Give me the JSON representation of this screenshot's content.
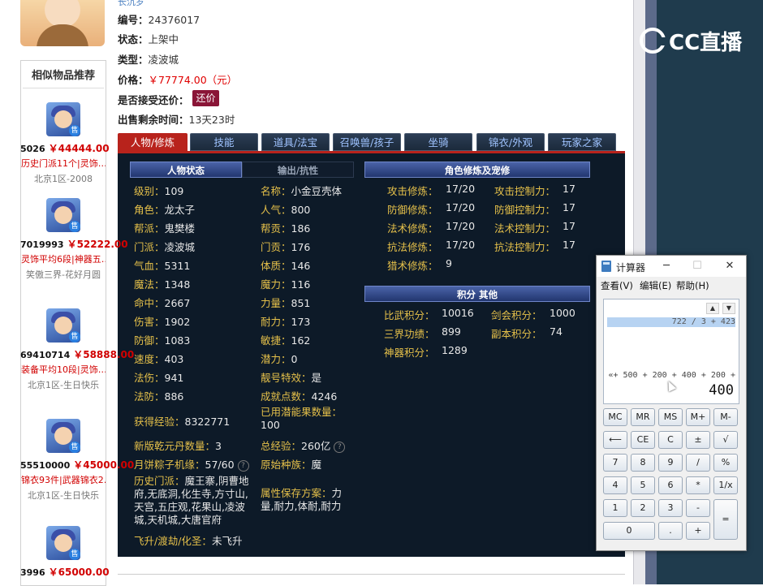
{
  "left": {
    "similar_title": "相似物品推荐",
    "items": [
      {
        "id": "5026",
        "price": "￥44444.00",
        "desc": "历史门派11个|灵饰…",
        "server": "北京1区-2008"
      },
      {
        "id": "7019993",
        "price": "￥52222.00",
        "desc": "灵饰平均6段|神器五…",
        "server": "笑傲三界-花好月圆"
      },
      {
        "id": "69410714",
        "price": "￥58888.00",
        "desc": "装备平均10段|灵饰…",
        "server": "北京1区-生日快乐"
      },
      {
        "id": "55510000",
        "price": "￥45000.00",
        "desc": "锦衣93件|武器锦衣2…",
        "server": "北京1区-生日快乐"
      },
      {
        "id": "3996",
        "price": "￥65000.00",
        "desc": "",
        "server": ""
      }
    ],
    "sold_badge": "售"
  },
  "info": {
    "top_cut": "长沉岁",
    "id_label": "编号：",
    "id_value": "24376017",
    "status_label": "状态：",
    "status_value": "上架中",
    "type_label": "类型：",
    "type_value": "凌波城",
    "price_label": "价格：",
    "price_value": "￥77774.00（元）",
    "bargain_label": "是否接受还价：",
    "bargain_button": "还价",
    "remaining_label": "出售剩余时间：",
    "remaining_value": "13天23时"
  },
  "tabs": [
    "人物/修炼",
    "技能",
    "道具/法宝",
    "召唤兽/孩子",
    "坐骑",
    "锦衣/外观",
    "玩家之家"
  ],
  "panel": {
    "hdr_status": "人物状态",
    "hdr_attack": "输出/抗性",
    "hdr_cultivation": "角色修炼及宠修",
    "hdr_points": "积分 其他",
    "col1": [
      {
        "k": "级别：",
        "v": "109"
      },
      {
        "k": "角色：",
        "v": "龙太子"
      },
      {
        "k": "帮派：",
        "v": "鬼樊楼"
      },
      {
        "k": "门派：",
        "v": "凌波城"
      },
      {
        "k": "气血：",
        "v": "5311"
      },
      {
        "k": "魔法：",
        "v": "1348"
      },
      {
        "k": "命中：",
        "v": "2667"
      },
      {
        "k": "伤害：",
        "v": "1902"
      },
      {
        "k": "防御：",
        "v": "1083"
      },
      {
        "k": "速度：",
        "v": "403"
      },
      {
        "k": "法伤：",
        "v": "941"
      },
      {
        "k": "法防：",
        "v": "886"
      }
    ],
    "col2": [
      {
        "k": "名称：",
        "v": "小金豆壳体"
      },
      {
        "k": "人气：",
        "v": "800"
      },
      {
        "k": "帮贡：",
        "v": "186"
      },
      {
        "k": "门贡：",
        "v": "176"
      },
      {
        "k": "体质：",
        "v": "146"
      },
      {
        "k": "魔力：",
        "v": "116"
      },
      {
        "k": "力量：",
        "v": "851"
      },
      {
        "k": "耐力：",
        "v": "173"
      },
      {
        "k": "敏捷：",
        "v": "162"
      },
      {
        "k": "潜力：",
        "v": "0"
      },
      {
        "k": "靓号特效：",
        "v": "是"
      },
      {
        "k": "成就点数：",
        "v": "4246"
      }
    ],
    "exp_label": "获得经验：",
    "exp_value": "8322771",
    "potential_label": "已用潜能果数量：",
    "potential_value": "100",
    "qianyuan_label": "新版乾元丹数量：",
    "qianyuan_value": "3",
    "total_exp_label": "总经验：",
    "total_exp_value": "260亿",
    "yuebing_label": "月饼粽子机缘：",
    "yuebing_value": "57/60",
    "race_label": "原始种族：",
    "race_value": "魔",
    "history_label": "历史门派：",
    "history_value": "魔王寨,阴曹地府,无底洞,化生寺,方寸山,天宫,五庄观,花果山,凌波城,天机城,大唐官府",
    "save_label": "属性保存方案：",
    "save_value": "力量,耐力,体耐,耐力",
    "fly_label": "飞升/渡劫/化圣：",
    "fly_value": "未飞升",
    "help_glyph": "?",
    "cult": [
      {
        "k": "攻击修炼：",
        "v": "17/20",
        "k2": "攻击控制力：",
        "v2": "17"
      },
      {
        "k": "防御修炼：",
        "v": "17/20",
        "k2": "防御控制力：",
        "v2": "17"
      },
      {
        "k": "法术修炼：",
        "v": "17/20",
        "k2": "法术控制力：",
        "v2": "17"
      },
      {
        "k": "抗法修炼：",
        "v": "17/20",
        "k2": "抗法控制力：",
        "v2": "17"
      },
      {
        "k": "猎术修炼：",
        "v": "9",
        "k2": "",
        "v2": ""
      }
    ],
    "points": [
      {
        "k": "比武积分：",
        "v": "10016",
        "k2": "剑会积分：",
        "v2": "1000"
      },
      {
        "k": "三界功绩：",
        "v": "899",
        "k2": "副本积分：",
        "v2": "74"
      },
      {
        "k": "神器积分：",
        "v": "1289",
        "k2": "",
        "v2": ""
      }
    ]
  },
  "overlay": {
    "logo": "CC直播"
  },
  "calculator": {
    "title": "计算器",
    "minimize": "─",
    "maximize": "☐",
    "close": "✕",
    "menu": [
      "查看(V)",
      "编辑(E)",
      "帮助(H)"
    ],
    "history": "722 / 3 + 423",
    "expression": "«+ 500 + 200 + 400 + 200 +",
    "value": "400",
    "scroll_up": "▲",
    "scroll_down": "▼",
    "rows": [
      [
        "MC",
        "MR",
        "MS",
        "M+",
        "M-"
      ],
      [
        "⟵",
        "CE",
        "C",
        "±",
        "√"
      ],
      [
        "7",
        "8",
        "9",
        "/",
        "%"
      ],
      [
        "4",
        "5",
        "6",
        "*",
        "1/x"
      ],
      [
        "1",
        "2",
        "3",
        "-",
        "="
      ],
      [
        "0",
        ".",
        "+"
      ]
    ]
  }
}
